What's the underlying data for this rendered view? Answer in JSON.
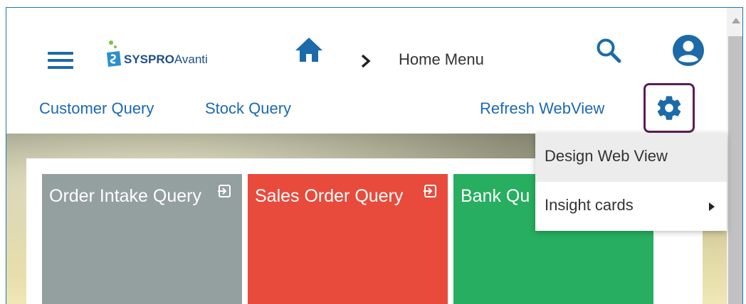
{
  "header": {
    "logo_text_main": "SYSPRO",
    "logo_text_sub": "Avanti",
    "breadcrumb": "Home Menu",
    "icons": [
      "hamburger-menu-icon",
      "home-icon",
      "chevron-right-icon",
      "search-icon",
      "user-account-icon"
    ]
  },
  "toolbar": {
    "links": [
      "Customer Query",
      "Stock Query"
    ],
    "refresh_label": "Refresh WebView",
    "settings_icon": "gear-icon"
  },
  "tiles": [
    {
      "title": "Order Intake Query",
      "color": "#949fa0",
      "icon": "launch-icon"
    },
    {
      "title": "Sales Order Query",
      "color": "#e84b3c",
      "icon": "launch-icon"
    },
    {
      "title": "Bank Qu",
      "color": "#27ae60"
    }
  ],
  "menu": {
    "items": [
      {
        "label": "Design Web View"
      },
      {
        "label": "Insight cards",
        "submenu": true
      }
    ]
  },
  "colors": {
    "accent": "#1b69b1",
    "gear_highlight": "#5b1f56",
    "frame_border": "#1e74b8"
  }
}
